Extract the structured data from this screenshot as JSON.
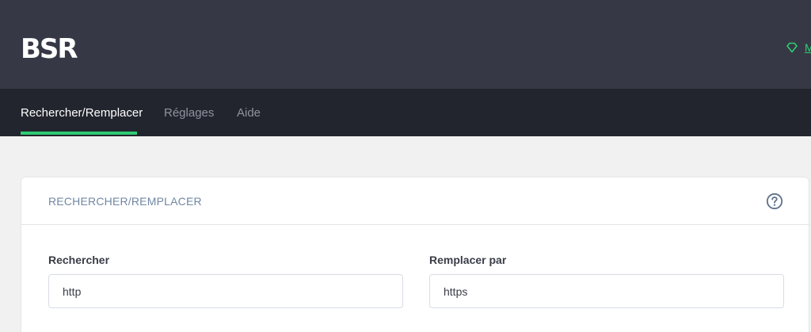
{
  "header": {
    "logo_text": "BSR",
    "upgrade_label": "M",
    "upgrade_icon": "diamond-icon",
    "accent_color": "#2ecc71"
  },
  "nav": {
    "tabs": [
      {
        "label": "Rechercher/Remplacer",
        "active": true
      },
      {
        "label": "Réglages",
        "active": false
      },
      {
        "label": "Aide",
        "active": false
      }
    ]
  },
  "card": {
    "title": "RECHERCHER/REMPLACER",
    "help_icon": "question-circle-icon",
    "search": {
      "label": "Rechercher",
      "value": "http"
    },
    "replace": {
      "label": "Remplacer par",
      "value": "https"
    }
  }
}
